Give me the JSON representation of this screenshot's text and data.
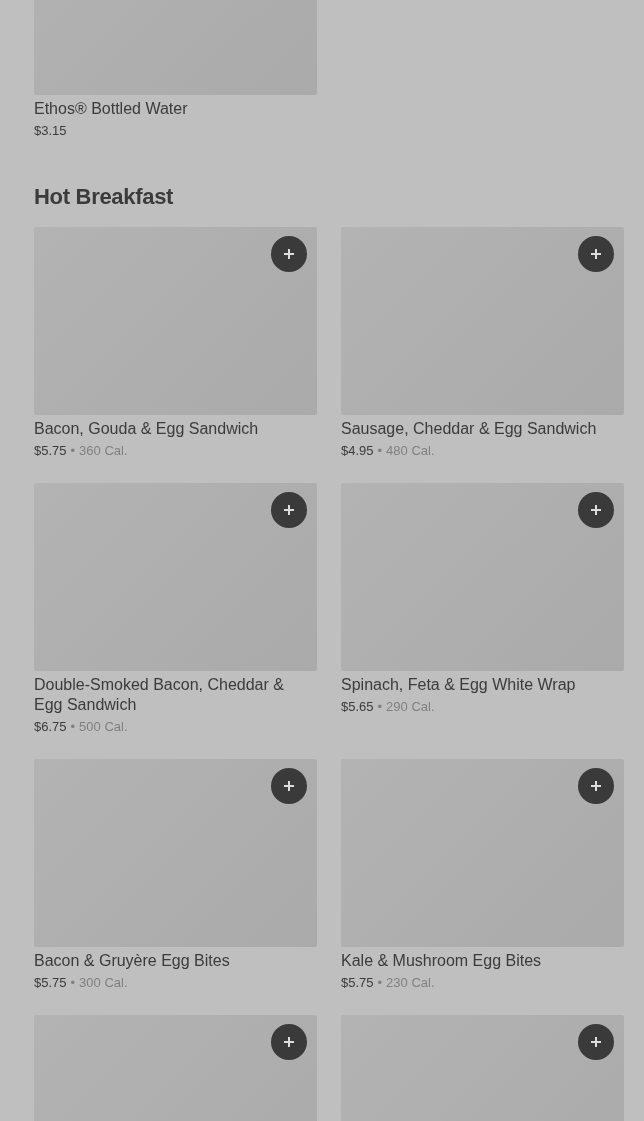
{
  "top_items": [
    {
      "name": "Ethos® Bottled Water",
      "price": "$3.15",
      "add_button": false
    }
  ],
  "section": {
    "title": "Hot Breakfast",
    "items": [
      {
        "name": "Bacon, Gouda & Egg Sandwich",
        "price": "$5.75",
        "separator": "•",
        "calories": "360 Cal.",
        "add_button": true
      },
      {
        "name": "Sausage, Cheddar & Egg Sandwich",
        "price": "$4.95",
        "separator": "•",
        "calories": "480 Cal.",
        "add_button": true
      },
      {
        "name": "Double-Smoked Bacon, Cheddar & Egg Sandwich",
        "price": "$6.75",
        "separator": "•",
        "calories": "500 Cal.",
        "add_button": true
      },
      {
        "name": "Spinach, Feta & Egg White Wrap",
        "price": "$5.65",
        "separator": "•",
        "calories": "290 Cal.",
        "add_button": true
      },
      {
        "name": "Bacon & Gruyère Egg Bites",
        "price": "$5.75",
        "separator": "•",
        "calories": "300 Cal.",
        "add_button": true
      },
      {
        "name": "Kale & Mushroom Egg Bites",
        "price": "$5.75",
        "separator": "•",
        "calories": "230 Cal.",
        "add_button": true
      },
      {
        "add_button": true
      },
      {
        "add_button": true
      }
    ]
  }
}
